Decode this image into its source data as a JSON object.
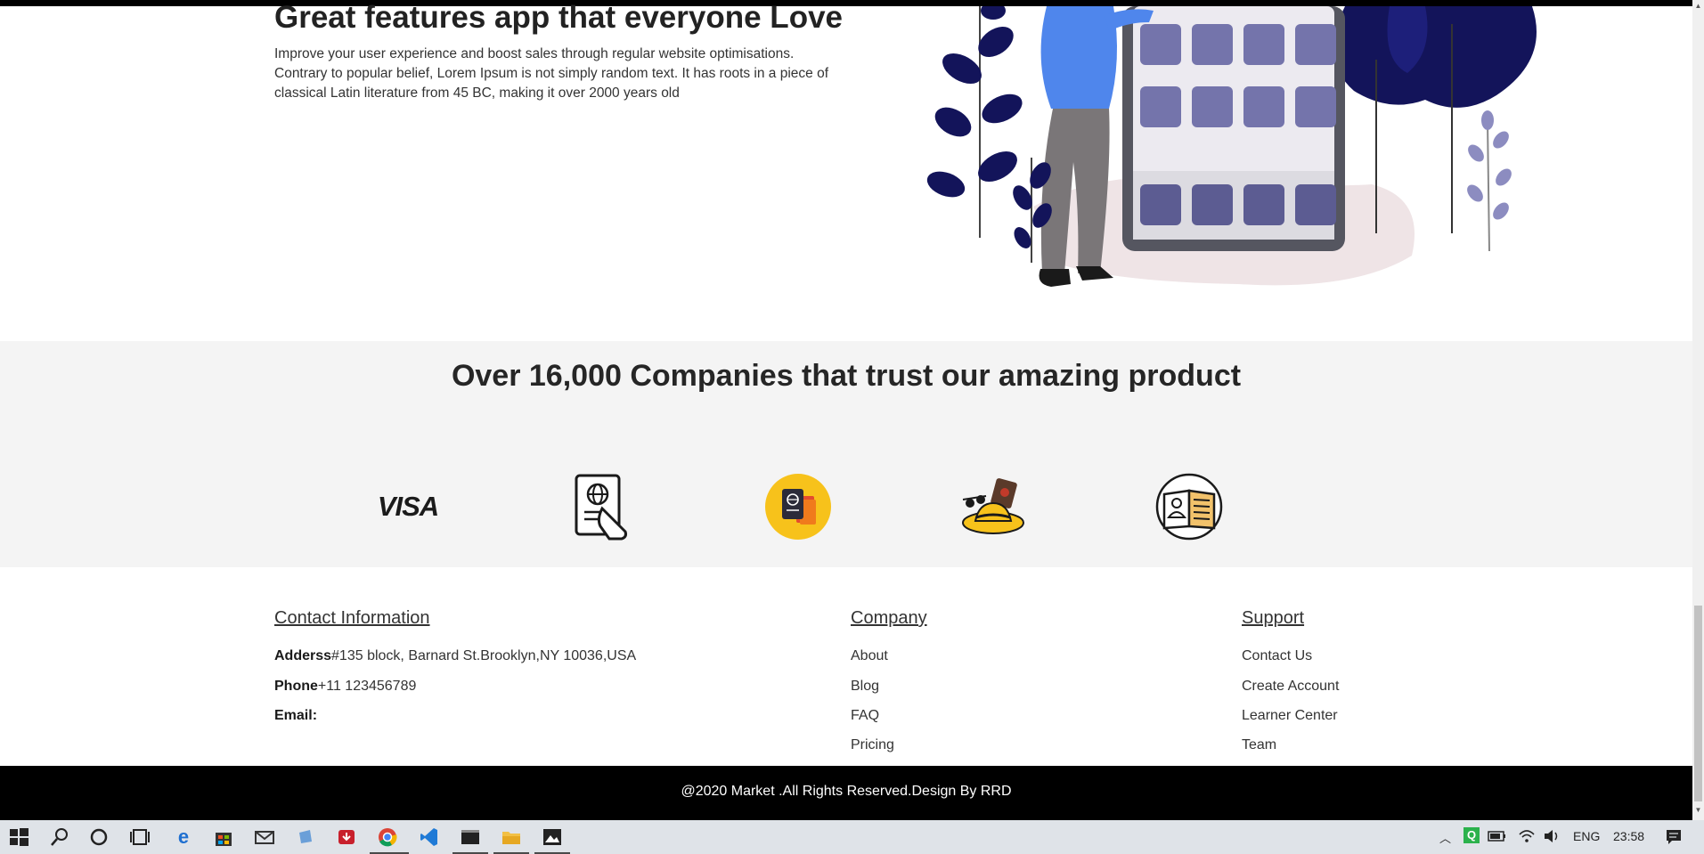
{
  "hero": {
    "title": "Great features app that everyone Love",
    "text": "Improve your user experience and boost sales through regular website optimisations. Contrary to popular belief, Lorem Ipsum is not simply random text. It has roots in a piece of classical Latin literature from 45 BC, making it over 2000 years old"
  },
  "companies": {
    "title": "Over 16,000 Companies that trust our amazing product",
    "logos": [
      "visa-logo",
      "passport-hand-icon",
      "passport-circle-icon",
      "travel-hat-icon",
      "id-book-icon"
    ],
    "visa_text": "VISA"
  },
  "footer": {
    "contact": {
      "heading": "Contact Information",
      "address_label": "Adderss",
      "address_value": "#135 block, Barnard St.Brooklyn,NY 10036,USA",
      "phone_label": "Phone",
      "phone_value": "+11 123456789",
      "email_label": "Email:"
    },
    "company": {
      "heading": "Company",
      "links": [
        "About",
        "Blog",
        "FAQ",
        "Pricing"
      ]
    },
    "support": {
      "heading": "Support",
      "links": [
        "Contact Us",
        "Create Account",
        "Learner Center",
        "Team"
      ]
    },
    "copyright": "@2020 Market .All Rights Reserved.Design By RRD"
  },
  "taskbar": {
    "icons": [
      "windows-start-icon",
      "search-icon",
      "cortana-icon",
      "task-view-icon",
      "edge-icon",
      "store-icon",
      "mail-icon",
      "app-icon",
      "download-icon",
      "chrome-icon",
      "vscode-icon",
      "terminal-icon",
      "file-explorer-icon",
      "photos-icon"
    ],
    "language": "ENG",
    "time": "23:58"
  },
  "colors": {
    "accent_dark_navy": "#13145a",
    "accent_blue": "#4f86ec",
    "icon_yellow": "#f7c21b"
  }
}
